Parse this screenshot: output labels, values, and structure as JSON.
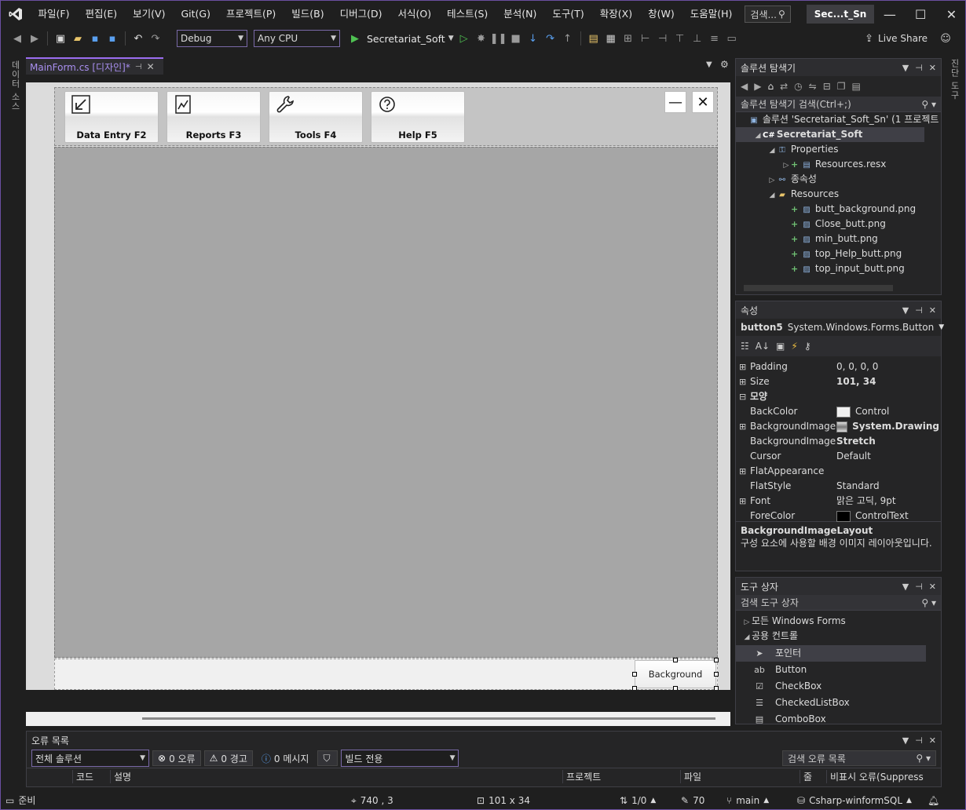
{
  "menu": [
    "파일(F)",
    "편집(E)",
    "보기(V)",
    "Git(G)",
    "프로젝트(P)",
    "빌드(B)",
    "디버그(D)",
    "서식(O)",
    "테스트(S)",
    "분석(N)",
    "도구(T)",
    "확장(X)",
    "창(W)",
    "도움말(H)"
  ],
  "search": {
    "label": "검색..."
  },
  "solution_short": "Sec...t_Sn",
  "toolbar": {
    "config": "Debug",
    "platform": "Any CPU",
    "run_target": "Secretariat_Soft",
    "live_share": "Live Share"
  },
  "left_strip": {
    "label": "데이터 소스"
  },
  "right_strip": {
    "label": "진단 도구"
  },
  "doc_tab": {
    "title": "MainForm.cs [디자인]*"
  },
  "form": {
    "nav_buttons": [
      {
        "label": "Data Entry F2",
        "icon": "arrow-down-left-icon"
      },
      {
        "label": "Reports F3",
        "icon": "chart-icon"
      },
      {
        "label": "Tools F4",
        "icon": "wrench-icon"
      },
      {
        "label": "Help F5",
        "icon": "help-icon"
      }
    ],
    "min_symbol": "—",
    "close_symbol": "✕",
    "background_button": "Background"
  },
  "solution_explorer": {
    "title": "솔루션 탐색기",
    "search": "솔루션 탐색기 검색(Ctrl+;)",
    "items": [
      {
        "label": "솔루션 'Secretariat_Soft_Sn' (1 프로젝트",
        "indent": 0
      },
      {
        "label": "Secretariat_Soft",
        "indent": 1
      },
      {
        "label": "Properties",
        "indent": 2
      },
      {
        "label": "Resources.resx",
        "indent": 3
      },
      {
        "label": "종속성",
        "indent": 2
      },
      {
        "label": "Resources",
        "indent": 2
      },
      {
        "label": "butt_background.png",
        "indent": 3
      },
      {
        "label": "Close_butt.png",
        "indent": 3
      },
      {
        "label": "min_butt.png",
        "indent": 3
      },
      {
        "label": "top_Help_butt.png",
        "indent": 3
      },
      {
        "label": "top_input_butt.png",
        "indent": 3
      }
    ]
  },
  "properties": {
    "title": "속성",
    "object": "button5",
    "object_type": "System.Windows.Forms.Button",
    "rows": [
      {
        "name": "Padding",
        "value": "0, 0, 0, 0",
        "expand": "⊞"
      },
      {
        "name": "Size",
        "value": "101, 34",
        "expand": "⊞"
      },
      {
        "name": "모양",
        "value": "",
        "expand": "⊟"
      },
      {
        "name": "BackColor",
        "value": "Control",
        "expand": ""
      },
      {
        "name": "BackgroundImage",
        "value": "System.Drawing",
        "expand": "⊞"
      },
      {
        "name": "BackgroundImageL",
        "value": "Stretch",
        "expand": ""
      },
      {
        "name": "Cursor",
        "value": "Default",
        "expand": ""
      },
      {
        "name": "FlatAppearance",
        "value": "",
        "expand": "⊞"
      },
      {
        "name": "FlatStyle",
        "value": "Standard",
        "expand": ""
      },
      {
        "name": "Font",
        "value": "맑은 고딕, 9pt",
        "expand": "⊞"
      },
      {
        "name": "ForeColor",
        "value": "ControlText",
        "expand": ""
      }
    ],
    "desc_title": "BackgroundImageLayout",
    "desc_text": "구성 요소에 사용할 배경 이미지 레이아웃입니다."
  },
  "toolbox": {
    "title": "도구 상자",
    "search": "검색 도구 상자",
    "group_all": "모든 Windows Forms",
    "group_common": "공용 컨트롤",
    "items": [
      "포인터",
      "Button",
      "CheckBox",
      "CheckedListBox",
      "ComboBox"
    ]
  },
  "error_list": {
    "title": "오류 목록",
    "scope": "전체 솔루션",
    "errors": "0 오류",
    "warnings": "0 경고",
    "messages": "0 메시지",
    "build_filter": "빌드 전용",
    "search": "검색 오류 목록",
    "columns": [
      "코드",
      "설명",
      "프로젝트",
      "파일",
      "줄",
      "비표시 오류(Suppress"
    ]
  },
  "status": {
    "ready": "준비",
    "position": "740 , 3",
    "size": "101 x 34",
    "lines": "1/0",
    "edits": "70",
    "branch": "main",
    "repo": "Csharp-winformSQL"
  },
  "colors": {
    "accent": "#9b6df0",
    "panel": "#252526",
    "form_gray": "#a6a6a6"
  }
}
